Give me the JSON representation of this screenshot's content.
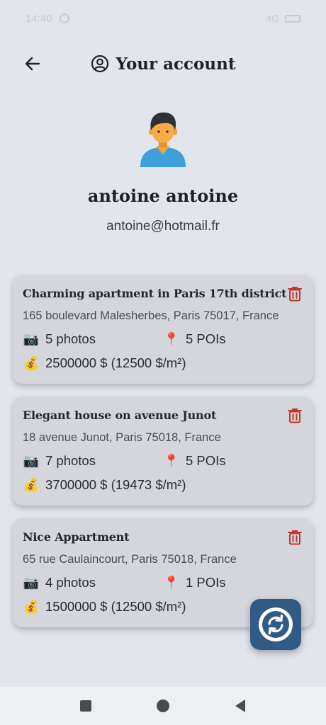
{
  "status_bar": {
    "time": "14:40",
    "signal": "4G"
  },
  "header": {
    "title": "Your account"
  },
  "user": {
    "name": "antoine antoine",
    "email": "antoine@hotmail.fr"
  },
  "properties": [
    {
      "title": "Charming apartment in Paris 17th district",
      "address": "165 boulevard Malesherbes, Paris 75017, France",
      "photos": "5 photos",
      "pois": "5 POIs",
      "price": "2500000 $ (12500 $/m²)"
    },
    {
      "title": "Elegant house on avenue Junot",
      "address": "18 avenue Junot, Paris 75018, France",
      "photos": "7 photos",
      "pois": "5 POIs",
      "price": "3700000 $ (19473 $/m²)"
    },
    {
      "title": "Nice Appartment",
      "address": "65 rue Caulaincourt, Paris 75018, France",
      "photos": "4 photos",
      "pois": "1 POIs",
      "price": "1500000 $ (12500 $/m²)"
    }
  ],
  "icons": {
    "photos": "📷",
    "pois": "📍",
    "price": "💰"
  },
  "colors": {
    "background": "#e3e5ec",
    "card": "#d5d6dc",
    "delete": "#c0392b",
    "fab": "#2f5b85"
  }
}
